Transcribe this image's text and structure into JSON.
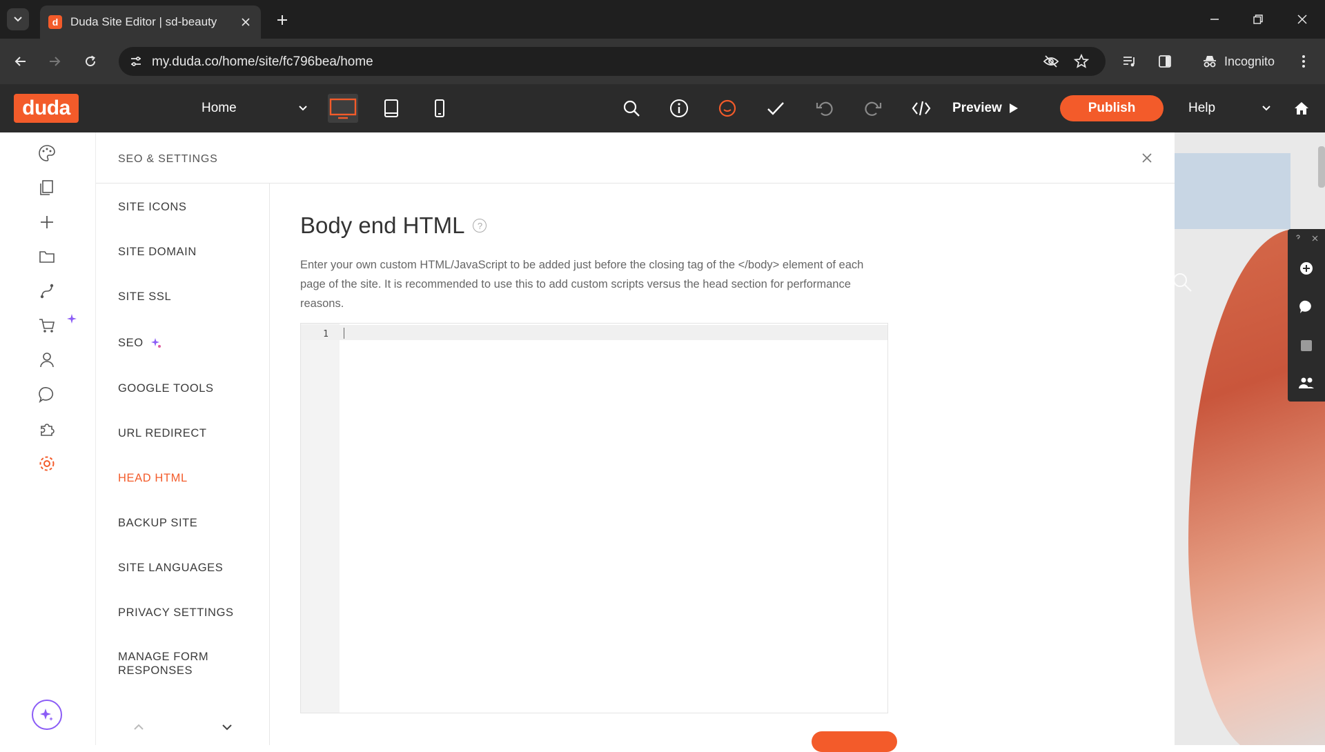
{
  "browser": {
    "tab_title": "Duda Site Editor | sd-beauty",
    "favicon_letter": "d",
    "url": "my.duda.co/home/site/fc796bea/home",
    "profile_label": "Incognito"
  },
  "editor": {
    "logo": "duda",
    "page_select": "Home",
    "preview_label": "Preview",
    "publish_label": "Publish",
    "help_label": "Help",
    "accent_color": "#f35b2a"
  },
  "panel": {
    "title": "SEO & SETTINGS",
    "nav": [
      {
        "label": "SITE ICONS"
      },
      {
        "label": "SITE DOMAIN"
      },
      {
        "label": "SITE SSL"
      },
      {
        "label": "SEO"
      },
      {
        "label": "GOOGLE TOOLS"
      },
      {
        "label": "URL REDIRECT"
      },
      {
        "label": "HEAD HTML"
      },
      {
        "label": "BACKUP SITE"
      },
      {
        "label": "SITE LANGUAGES"
      },
      {
        "label": "PRIVACY SETTINGS"
      },
      {
        "label": "MANAGE FORM RESPONSES"
      }
    ],
    "active_item": "HEAD HTML"
  },
  "content": {
    "title": "Body end HTML",
    "help_glyph": "?",
    "description": "Enter your own custom HTML/JavaScript to be added just before the closing tag of the </body> element of each page of the site. It is recommended to use this to add custom scripts versus the head section for performance reasons.",
    "editor": {
      "line_number": "1",
      "value": ""
    }
  }
}
